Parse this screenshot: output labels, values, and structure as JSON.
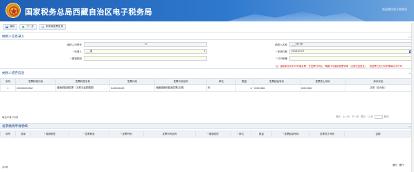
{
  "header": {
    "title": "国家税务总局西藏自治区电子税务局",
    "welcome": "欢迎使用电子税务局"
  },
  "toolbar": {
    "save": "保存",
    "next": "下一步",
    "query": "未申请发票查询"
  },
  "taxpayer_section": {
    "title": "纳税人信息录入",
    "fields": {
      "taxpayer_id_label": "纳税人识别号",
      "taxpayer_id_value": "17",
      "taxpayer_name_label": "纳税人名称",
      "taxpayer_name_value": "___村门市",
      "applicant_label": "申请人",
      "applicant_value": "___夏",
      "apply_date_label": "申请日期",
      "apply_date_value": "2018-09-07",
      "reason_label": "缴销原因",
      "reason_value": "",
      "attachment_label": "打印刷槽",
      "attachment_value": ""
    },
    "notice": "注：缴销前请先打印作废发票，在发票打印后，需要打印缴销发票清单（出现在回显处），若发票已无打印的需确认不打印"
  },
  "stock_section": {
    "title": "纳税人结存信息",
    "columns": [
      "序号",
      "发票种类代码",
      "发票种类名称",
      "发票代码",
      "发票代码名称",
      "单位",
      "数量",
      "发票起始号码",
      "发票终止号码",
      "库存状态"
    ],
    "rows": [
      {
        "no": "1",
        "type_code": "000008101500",
        "type_name": "增值税普通发票（五联无金额限额）",
        "invoice_code": "5400001650",
        "code_name": "西藏增值税普通发票(五联)",
        "unit": "份",
        "qty": "6",
        "start_no": "00012685",
        "end_no": "00012690",
        "status": "正常（自动化）"
      }
    ],
    "pager": {
      "left": "每页10条 共1条",
      "first": "首页",
      "prev": "上一页",
      "next": "下一页",
      "last": "尾页",
      "page": "1/1页",
      "goto": "跳转"
    }
  },
  "apply_section": {
    "title": "发票缴销申请明细",
    "columns": [
      "序号",
      "选择",
      "缴销类型",
      "发票种类",
      "发票代码",
      "发票代码名称",
      "缴销类型",
      "单位",
      "数量",
      "发票起始号码",
      "发票终止号码",
      "金额"
    ],
    "footer_left": "共0条",
    "footer_btns": [
      "增行",
      "删行"
    ]
  }
}
